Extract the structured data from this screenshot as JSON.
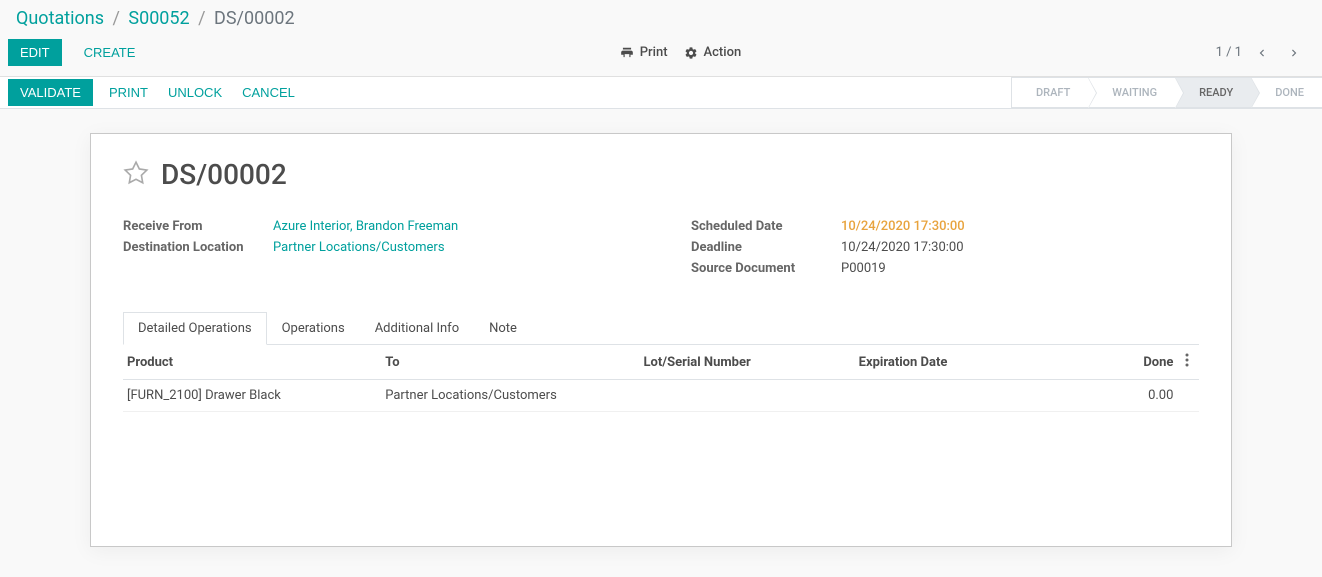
{
  "breadcrumb": {
    "items": [
      {
        "label": "Quotations",
        "link": true
      },
      {
        "label": "S00052",
        "link": true
      },
      {
        "label": "DS/00002",
        "link": false
      }
    ]
  },
  "toolbar": {
    "edit": "Edit",
    "create": "Create",
    "print": "Print",
    "action": "Action",
    "pager": "1 / 1"
  },
  "statusbar": {
    "validate": "Validate",
    "print": "Print",
    "unlock": "Unlock",
    "cancel": "Cancel",
    "stages": [
      "Draft",
      "Waiting",
      "Ready",
      "Done"
    ],
    "active_stage": "Ready"
  },
  "document": {
    "title": "DS/00002"
  },
  "fields_left": {
    "receive_from": {
      "label": "Receive From",
      "value": "Azure Interior, Brandon Freeman",
      "link": true
    },
    "destination": {
      "label": "Destination Location",
      "value": "Partner Locations/Customers",
      "link": true
    }
  },
  "fields_right": {
    "scheduled": {
      "label": "Scheduled Date",
      "value": "10/24/2020 17:30:00",
      "warn": true
    },
    "deadline": {
      "label": "Deadline",
      "value": "10/24/2020 17:30:00"
    },
    "source_doc": {
      "label": "Source Document",
      "value": "P00019"
    }
  },
  "tabs": {
    "items": [
      "Detailed Operations",
      "Operations",
      "Additional Info",
      "Note"
    ],
    "active": "Detailed Operations"
  },
  "table": {
    "headers": {
      "product": "Product",
      "to": "To",
      "lot": "Lot/Serial Number",
      "expiration": "Expiration Date",
      "done": "Done"
    },
    "rows": [
      {
        "product": "[FURN_2100] Drawer Black",
        "to": "Partner Locations/Customers",
        "lot": "",
        "expiration": "",
        "done": "0.00"
      }
    ]
  }
}
